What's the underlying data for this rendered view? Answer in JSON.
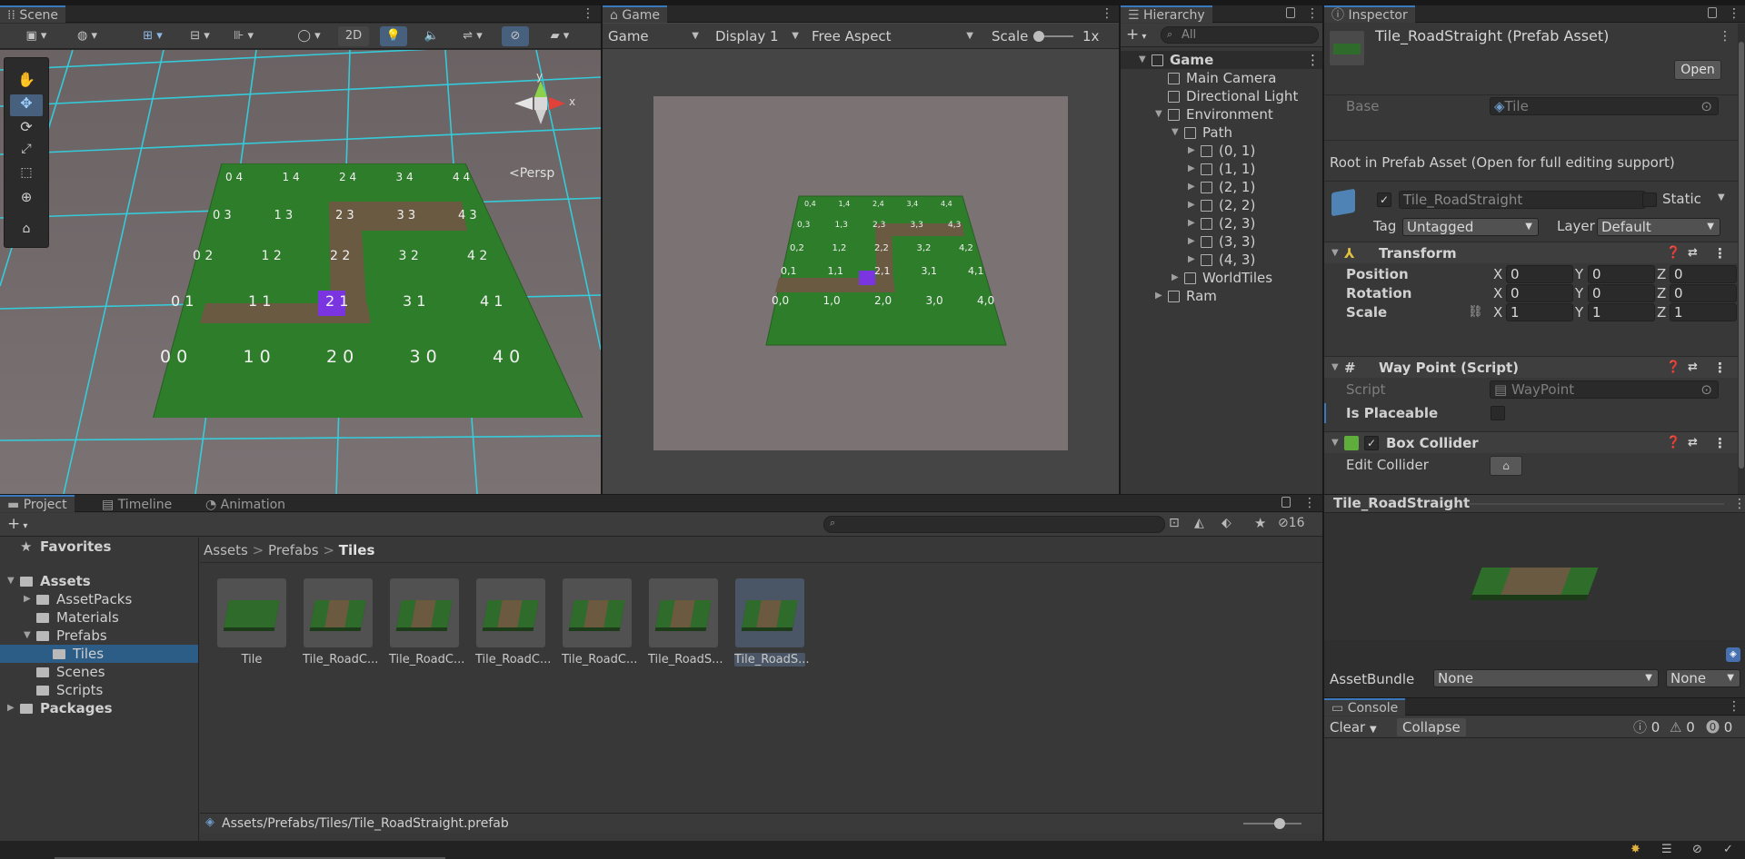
{
  "scene": {
    "tab": "Scene",
    "view_mode": "2D",
    "persp_label": "Persp",
    "tiles": [
      [
        "0 4",
        "1 4",
        "2 4",
        "3 4",
        "4 4"
      ],
      [
        "0 3",
        "1 3",
        "2 3",
        "3 3",
        "4 3"
      ],
      [
        "0 2",
        "1 2",
        "2 2",
        "3 2",
        "4 2"
      ],
      [
        "0 1",
        "1 1",
        "2 1",
        "3 1",
        "4 1"
      ],
      [
        "0 0",
        "1 0",
        "2 0",
        "3 0",
        "4 0"
      ]
    ],
    "gizmo_x": "x",
    "gizmo_y": "y"
  },
  "game": {
    "tab": "Game",
    "mode_dropdown": "Game",
    "display_dropdown": "Display 1",
    "aspect_dropdown": "Free Aspect",
    "scale_label": "Scale",
    "scale_value": "1x",
    "tiles": [
      [
        "0,4",
        "1,4",
        "2,4",
        "3,4",
        "4,4"
      ],
      [
        "0,3",
        "1,3",
        "2,3",
        "3,3",
        "4,3"
      ],
      [
        "0,2",
        "1,2",
        "2,2",
        "3,2",
        "4,2"
      ],
      [
        "0,1",
        "1,1",
        "2,1",
        "3,1",
        "4,1"
      ],
      [
        "0,0",
        "1,0",
        "2,0",
        "3,0",
        "4,0"
      ]
    ]
  },
  "hierarchy": {
    "tab": "Hierarchy",
    "search_placeholder": "All",
    "items": [
      {
        "label": "Game",
        "depth": 0,
        "expanded": true,
        "bold": true
      },
      {
        "label": "Main Camera",
        "depth": 1
      },
      {
        "label": "Directional Light",
        "depth": 1
      },
      {
        "label": "Environment",
        "depth": 1,
        "expanded": true
      },
      {
        "label": "Path",
        "depth": 2,
        "expanded": true
      },
      {
        "label": "(0, 1)",
        "depth": 3,
        "collapsed": true
      },
      {
        "label": "(1, 1)",
        "depth": 3,
        "collapsed": true
      },
      {
        "label": "(2, 1)",
        "depth": 3,
        "collapsed": true
      },
      {
        "label": "(2, 2)",
        "depth": 3,
        "collapsed": true
      },
      {
        "label": "(2, 3)",
        "depth": 3,
        "collapsed": true
      },
      {
        "label": "(3, 3)",
        "depth": 3,
        "collapsed": true
      },
      {
        "label": "(4, 3)",
        "depth": 3,
        "collapsed": true
      },
      {
        "label": "WorldTiles",
        "depth": 2,
        "collapsed": true
      },
      {
        "label": "Ram",
        "depth": 1,
        "collapsed": true
      }
    ]
  },
  "inspector": {
    "tab": "Inspector",
    "asset_title": "Tile_RoadStraight (Prefab Asset)",
    "open_button": "Open",
    "base_label": "Base",
    "base_value": "Tile",
    "root_note": "Root in Prefab Asset (Open for full editing support)",
    "object_name": "Tile_RoadStraight",
    "static_label": "Static",
    "tag_label": "Tag",
    "tag_value": "Untagged",
    "layer_label": "Layer",
    "layer_value": "Default",
    "transform": {
      "title": "Transform",
      "position_label": "Position",
      "rotation_label": "Rotation",
      "scale_label": "Scale",
      "position": [
        "0",
        "0",
        "0"
      ],
      "rotation": [
        "0",
        "0",
        "0"
      ],
      "scale": [
        "1",
        "1",
        "1"
      ],
      "axis_x": "X",
      "axis_y": "Y",
      "axis_z": "Z"
    },
    "waypoint": {
      "title": "Way Point (Script)",
      "script_label": "Script",
      "script_value": "WayPoint",
      "placeable_label": "Is Placeable"
    },
    "box_collider": {
      "title": "Box Collider",
      "edit_label": "Edit Collider"
    },
    "preview_title": "Tile_RoadStraight",
    "assetbundle_label": "AssetBundle",
    "assetbundle_value": "None",
    "assetbundle_variant": "None"
  },
  "console": {
    "tab": "Console",
    "clear_label": "Clear",
    "collapse_label": "Collapse",
    "info_count": "0",
    "warn_count": "0",
    "error_count": "0"
  },
  "project": {
    "tabs": [
      "Project",
      "Timeline",
      "Animation"
    ],
    "hidden_count": "16",
    "tree": [
      {
        "label": "Favorites",
        "depth": 0,
        "bold": true,
        "star": true
      },
      {
        "label": "Assets",
        "depth": 0,
        "bold": true,
        "expanded": true
      },
      {
        "label": "AssetPacks",
        "depth": 1,
        "collapsed": true
      },
      {
        "label": "Materials",
        "depth": 1
      },
      {
        "label": "Prefabs",
        "depth": 1,
        "expanded": true
      },
      {
        "label": "Tiles",
        "depth": 2,
        "selected": true
      },
      {
        "label": "Scenes",
        "depth": 1
      },
      {
        "label": "Scripts",
        "depth": 1
      },
      {
        "label": "Packages",
        "depth": 0,
        "bold": true,
        "collapsed": true
      }
    ],
    "breadcrumb": [
      "Assets",
      "Prefabs",
      "Tiles"
    ],
    "assets": [
      {
        "label": "Tile",
        "road": false
      },
      {
        "label": "Tile_RoadC...",
        "road": true
      },
      {
        "label": "Tile_RoadC...",
        "road": true
      },
      {
        "label": "Tile_RoadC...",
        "road": true
      },
      {
        "label": "Tile_RoadC...",
        "road": true
      },
      {
        "label": "Tile_RoadS...",
        "road": true
      },
      {
        "label": "Tile_RoadS...",
        "road": true,
        "selected": true
      }
    ],
    "footer_path": "Assets/Prefabs/Tiles/Tile_RoadStraight.prefab"
  },
  "colors": {
    "grass": "#2e7d2a",
    "road": "#6b5a42",
    "cube": "#7a35e0",
    "grid": "#2fd6e6",
    "selection": "#2c5d87"
  }
}
